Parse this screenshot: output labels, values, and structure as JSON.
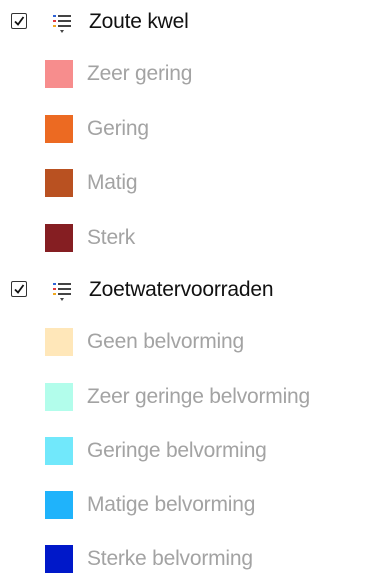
{
  "layers": [
    {
      "name": "Zoute kwel",
      "checked": true,
      "icon": "legend-list-icon",
      "items": [
        {
          "label": "Zeer gering",
          "color": "#f78d8d"
        },
        {
          "label": "Gering",
          "color": "#ec6a22"
        },
        {
          "label": "Matig",
          "color": "#b95121"
        },
        {
          "label": "Sterk",
          "color": "#851e22"
        }
      ]
    },
    {
      "name": "Zoetwatervoorraden",
      "checked": true,
      "icon": "legend-list-icon",
      "items": [
        {
          "label": "Geen belvorming",
          "color": "#ffe7b9"
        },
        {
          "label": "Zeer geringe belvorming",
          "color": "#b2fdeb"
        },
        {
          "label": "Geringe belvorming",
          "color": "#71e8fb"
        },
        {
          "label": "Matige belvorming",
          "color": "#1fb3fb"
        },
        {
          "label": "Sterke belvorming",
          "color": "#0018c9"
        }
      ]
    }
  ]
}
